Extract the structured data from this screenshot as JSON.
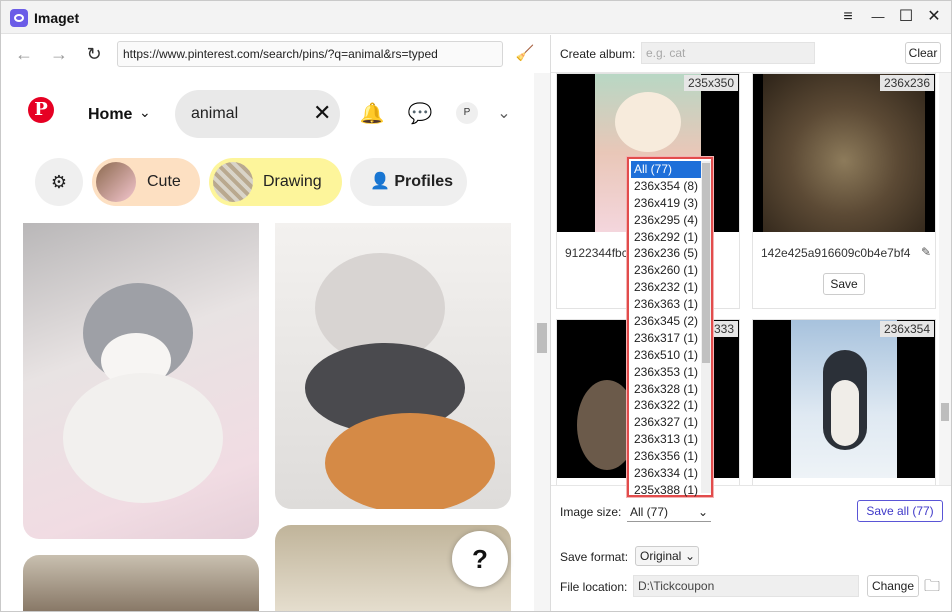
{
  "app": {
    "title": "Imaget"
  },
  "window_controls": {
    "menu": "≡",
    "minimize": "—",
    "maximize": "☐",
    "close": "✕"
  },
  "browser": {
    "url": "https://www.pinterest.com/search/pins/?q=animal&rs=typed",
    "nav": {
      "back": "←",
      "forward": "→",
      "reload": "↻",
      "clean": "🧹"
    }
  },
  "pinterest": {
    "logo": "P",
    "home_label": "Home",
    "search_value": "animal",
    "avatar_letter": "P",
    "chips": [
      {
        "label": "Cute",
        "bg": "#fde0c2"
      },
      {
        "label": "Drawing",
        "bg": "#fdf59b"
      },
      {
        "label": "Profiles",
        "bg": "#efefef"
      }
    ],
    "help": "?",
    "icons": [
      "filter-icon",
      "bell-icon",
      "chat-icon",
      "chevron-down-icon"
    ]
  },
  "panel": {
    "create_album_label": "Create album:",
    "album_placeholder": "e.g. cat",
    "clear_label": "Clear",
    "cards": [
      {
        "dim": "235x350",
        "name": "9122344fbc",
        "save": ""
      },
      {
        "dim": "236x236",
        "name": "142e425a916609c0b4e7bf4",
        "save": "Save"
      },
      {
        "dim": "333",
        "name": "",
        "save": ""
      },
      {
        "dim": "236x354",
        "name": "",
        "save": ""
      }
    ],
    "image_size_label": "Image size:",
    "image_size_value": "All (77)",
    "save_all_label": "Save all (77)",
    "save_format_label": "Save format:",
    "save_format_value": "Original",
    "file_location_label": "File location:",
    "file_location_value": "D:\\Tickcoupon",
    "change_label": "Change"
  },
  "size_options": [
    "All (77)",
    "236x354 (8)",
    "236x419 (3)",
    "236x295 (4)",
    "236x292 (1)",
    "236x236 (5)",
    "236x260 (1)",
    "236x232 (1)",
    "236x363 (1)",
    "236x345 (2)",
    "236x317 (1)",
    "236x510 (1)",
    "236x353 (1)",
    "236x328 (1)",
    "236x322 (1)",
    "236x327 (1)",
    "236x313 (1)",
    "236x356 (1)",
    "236x334 (1)",
    "235x388 (1)"
  ],
  "colors": {
    "accent": "#5a55d6",
    "pinterest_red": "#e60023",
    "highlight": "#e24c4c",
    "selected": "#1e6fd9"
  }
}
